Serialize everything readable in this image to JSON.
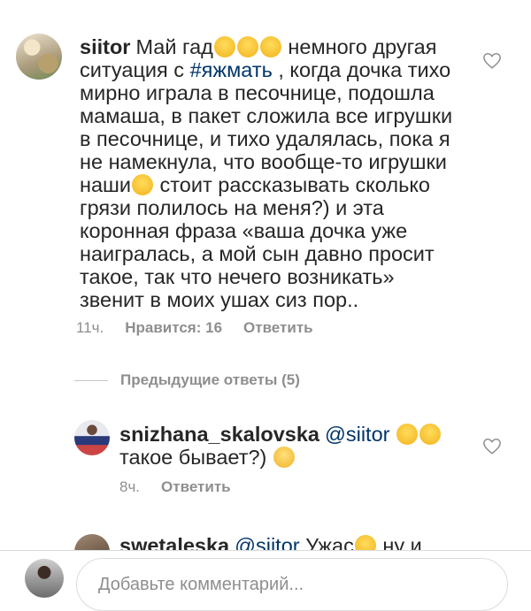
{
  "comments": [
    {
      "username": "siitor",
      "text_parts": {
        "p1": "Май гад",
        "p2": " немного другая ситуация с ",
        "hashtag": "#яжмать",
        "p3": " , когда дочка тихо мирно играла в песочнице, подошла мамаша, в пакет сложила все игрушки в песочнице, и тихо удалялась, пока я не намекнула, что вообще-то игрушки наши",
        "p4": " стоит рассказывать сколько грязи полилось на меня?) и эта коронная фраза «ваша дочка уже наигралась, а мой сын давно просит такое, так что нечего возникать» звенит в моих ушах сиз пор.."
      },
      "time": "11ч.",
      "likes": "Нравится: 16",
      "reply": "Ответить",
      "emoji_names": [
        "loudly-crying-face",
        "loudly-crying-face",
        "loudly-crying-face",
        "loudly-crying-face"
      ]
    },
    {
      "username": "snizhana_skalovska",
      "mention": "@siitor",
      "text_after": "такое бывает?)",
      "time": "8ч.",
      "reply": "Ответить",
      "emoji_names": [
        "relieved-face",
        "hushed-face",
        "disappointed-face"
      ]
    },
    {
      "username": "swetaleska",
      "mention": "@siitor",
      "text_partial": "Ужас",
      "text_tail": "ну и"
    }
  ],
  "replies_toggle": "Предыдущие ответы (5)",
  "composer": {
    "placeholder": "Добавьте комментарий..."
  },
  "colors": {
    "hashtag": "#003569",
    "secondary": "#8e8e8e",
    "text": "#262626"
  },
  "icons": {
    "like": "heart-outline-icon"
  }
}
